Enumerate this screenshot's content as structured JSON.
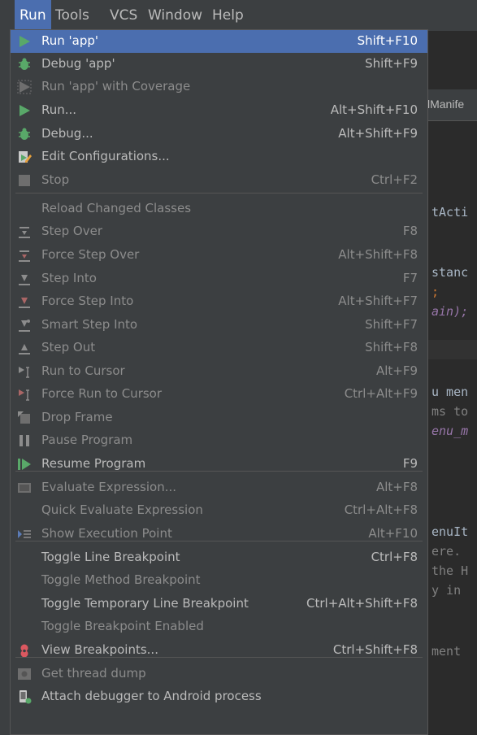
{
  "menubar": {
    "items": [
      {
        "id": "run",
        "label": "Run"
      },
      {
        "id": "tools",
        "label": "Tools"
      },
      {
        "id": "vcs",
        "label": "VCS"
      },
      {
        "id": "window",
        "label": "Window"
      },
      {
        "id": "help",
        "label": "Help"
      }
    ]
  },
  "editor": {
    "tab_label": "lManife",
    "code_lines": [
      "tActi",
      "stanc",
      ";",
      "ain);",
      "u men",
      "ms to",
      "enu_m",
      "enuIt",
      "ere.",
      "the H",
      "y in",
      "ment"
    ]
  },
  "run_menu": {
    "items": [
      {
        "label": "Run 'app'",
        "shortcut": "Shift+F10",
        "icon": "run-icon",
        "selected": true,
        "disabled": false
      },
      {
        "label": "Debug 'app'",
        "shortcut": "Shift+F9",
        "icon": "debug-icon",
        "disabled": false
      },
      {
        "label": "Run 'app' with Coverage",
        "shortcut": "",
        "icon": "coverage-icon",
        "disabled": true
      },
      {
        "label": "Run...",
        "shortcut": "Alt+Shift+F10",
        "icon": "run-icon",
        "disabled": false
      },
      {
        "label": "Debug...",
        "shortcut": "Alt+Shift+F9",
        "icon": "debug-icon",
        "disabled": false
      },
      {
        "label": "Edit Configurations...",
        "shortcut": "",
        "icon": "edit-config-icon",
        "disabled": false
      },
      {
        "label": "Stop",
        "shortcut": "Ctrl+F2",
        "icon": "stop-icon",
        "disabled": true
      },
      {
        "label": "Reload Changed Classes",
        "shortcut": "",
        "icon": "",
        "disabled": true
      },
      {
        "label": "Step Over",
        "shortcut": "F8",
        "icon": "step-over-icon",
        "disabled": true
      },
      {
        "label": "Force Step Over",
        "shortcut": "Alt+Shift+F8",
        "icon": "force-step-over-icon",
        "disabled": true
      },
      {
        "label": "Step Into",
        "shortcut": "F7",
        "icon": "step-into-icon",
        "disabled": true
      },
      {
        "label": "Force Step Into",
        "shortcut": "Alt+Shift+F7",
        "icon": "force-step-into-icon",
        "disabled": true
      },
      {
        "label": "Smart Step Into",
        "shortcut": "Shift+F7",
        "icon": "smart-step-into-icon",
        "disabled": true
      },
      {
        "label": "Step Out",
        "shortcut": "Shift+F8",
        "icon": "step-out-icon",
        "disabled": true
      },
      {
        "label": "Run to Cursor",
        "shortcut": "Alt+F9",
        "icon": "run-to-cursor-icon",
        "disabled": true
      },
      {
        "label": "Force Run to Cursor",
        "shortcut": "Ctrl+Alt+F9",
        "icon": "force-run-to-cursor-icon",
        "disabled": true
      },
      {
        "label": "Drop Frame",
        "shortcut": "",
        "icon": "drop-frame-icon",
        "disabled": true
      },
      {
        "label": "Pause Program",
        "shortcut": "",
        "icon": "pause-icon",
        "disabled": true
      },
      {
        "label": "Resume Program",
        "shortcut": "F9",
        "icon": "resume-icon",
        "disabled": false
      },
      {
        "label": "Evaluate Expression...",
        "shortcut": "Alt+F8",
        "icon": "evaluate-icon",
        "disabled": true
      },
      {
        "label": "Quick Evaluate Expression",
        "shortcut": "Ctrl+Alt+F8",
        "icon": "",
        "disabled": true
      },
      {
        "label": "Show Execution Point",
        "shortcut": "Alt+F10",
        "icon": "show-execution-point-icon",
        "disabled": true
      },
      {
        "label": "Toggle Line Breakpoint",
        "shortcut": "Ctrl+F8",
        "icon": "",
        "disabled": false
      },
      {
        "label": "Toggle Method Breakpoint",
        "shortcut": "",
        "icon": "",
        "disabled": true
      },
      {
        "label": "Toggle Temporary Line Breakpoint",
        "shortcut": "Ctrl+Alt+Shift+F8",
        "icon": "",
        "disabled": false
      },
      {
        "label": "Toggle Breakpoint Enabled",
        "shortcut": "",
        "icon": "",
        "disabled": true
      },
      {
        "label": "View Breakpoints...",
        "shortcut": "Ctrl+Shift+F8",
        "icon": "breakpoints-icon",
        "disabled": false
      },
      {
        "label": "Get thread dump",
        "shortcut": "",
        "icon": "thread-dump-icon",
        "disabled": true
      },
      {
        "label": "Attach debugger to Android process",
        "shortcut": "",
        "icon": "attach-debugger-icon",
        "disabled": false
      }
    ]
  },
  "colors": {
    "menu_bg": "#3c3f41",
    "selection": "#4b6eaf",
    "text_enabled": "#bbbbbb",
    "text_disabled": "#8c8c8c",
    "run_green": "#59a869",
    "breakpoint_red": "#db5860"
  }
}
